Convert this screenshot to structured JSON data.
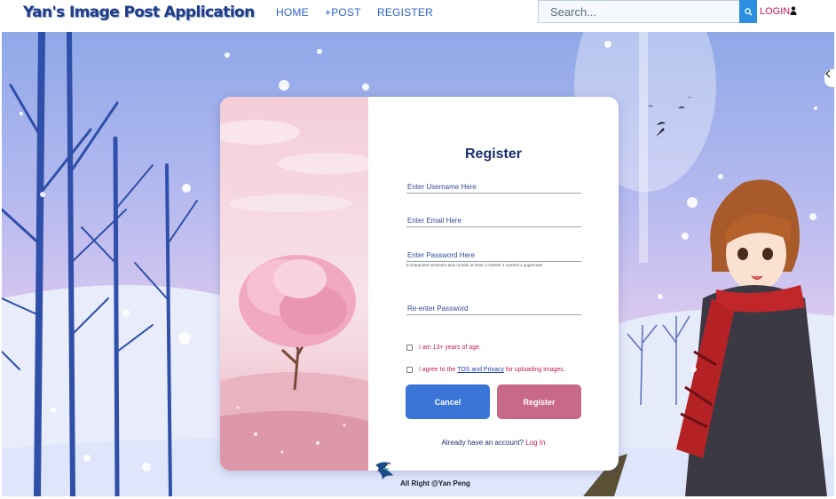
{
  "navbar": {
    "brand": "Yan's Image Post Application",
    "links": {
      "home": "HOME",
      "post": "+POST",
      "register": "REGISTER"
    },
    "search": {
      "placeholder": "Search..."
    },
    "login": "LOGIN"
  },
  "register_form": {
    "title": "Register",
    "fields": {
      "username": {
        "placeholder": "Enter Username Here"
      },
      "email": {
        "placeholder": "Enter Email Here"
      },
      "password": {
        "placeholder": "Enter Password Here",
        "hint": "8 characters minimum and contain at least 1 number 1 symbol 1 uppercase"
      },
      "confirm": {
        "placeholder": "Re-enter Password"
      }
    },
    "checkboxes": {
      "age": "I am 13+ years of age.",
      "tos_before": "I agree to the ",
      "tos_link": "TOS and Privacy",
      "tos_after": " for uploading images."
    },
    "buttons": {
      "cancel": "Cancel",
      "register": "Register"
    },
    "login_prompt": {
      "text": "Already have an account? ",
      "link": "Log In"
    }
  },
  "footer": {
    "text": "All Right @Yan Peng"
  },
  "colors": {
    "brand": "#1f3c8a",
    "nav_link": "#2c63c9",
    "login": "#c2185b",
    "cancel_button": "#3a74d6",
    "register_button": "#c8698a",
    "search_button": "#2b8fe0"
  },
  "icons": [
    "search-icon",
    "user-icon",
    "bird-logo-icon",
    "side-tab-icon"
  ]
}
